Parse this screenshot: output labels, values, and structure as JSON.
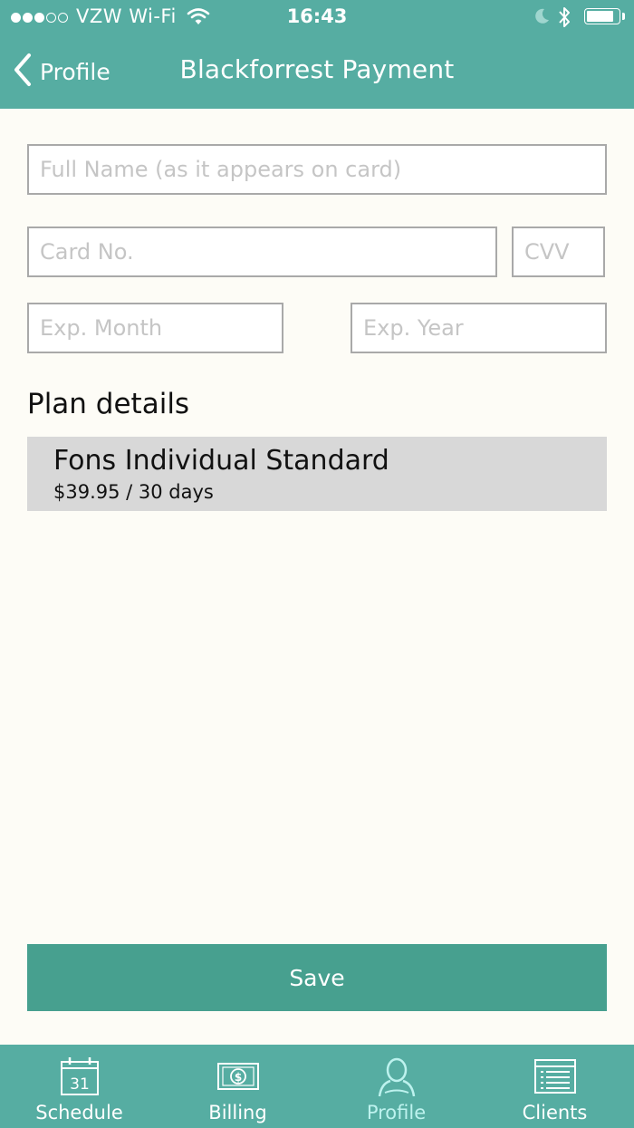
{
  "status_bar": {
    "signal_bars_filled": 3,
    "signal_bars_total": 5,
    "carrier": "VZW Wi-Fi",
    "time": "16:43",
    "icons": [
      "wifi-icon",
      "moon-icon",
      "bluetooth-icon",
      "battery-icon"
    ],
    "battery_level": 0.85
  },
  "nav": {
    "back_label": "Profile",
    "title": "Blackforrest Payment"
  },
  "form": {
    "full_name_placeholder": "Full Name (as it appears on card)",
    "full_name_value": "",
    "card_no_placeholder": "Card No.",
    "card_no_value": "",
    "cvv_placeholder": "CVV",
    "cvv_value": "",
    "exp_month_placeholder": "Exp. Month",
    "exp_month_value": "",
    "exp_year_placeholder": "Exp. Year",
    "exp_year_value": ""
  },
  "plan": {
    "section_title": "Plan details",
    "name": "Fons Individual Standard",
    "price": "$39.95 / 30 days"
  },
  "save_label": "Save",
  "tabs": [
    {
      "label": "Schedule",
      "icon": "calendar-icon",
      "calendar_day": "31"
    },
    {
      "label": "Billing",
      "icon": "dollar-bill-icon"
    },
    {
      "label": "Profile",
      "icon": "person-icon",
      "active": true
    },
    {
      "label": "Clients",
      "icon": "list-icon"
    }
  ],
  "colors": {
    "header": "#56ada2",
    "save_button": "#47a08f",
    "background": "#fdfcf6",
    "plan_card": "#d8d8d8",
    "active_tab": "#bdf2ee"
  }
}
